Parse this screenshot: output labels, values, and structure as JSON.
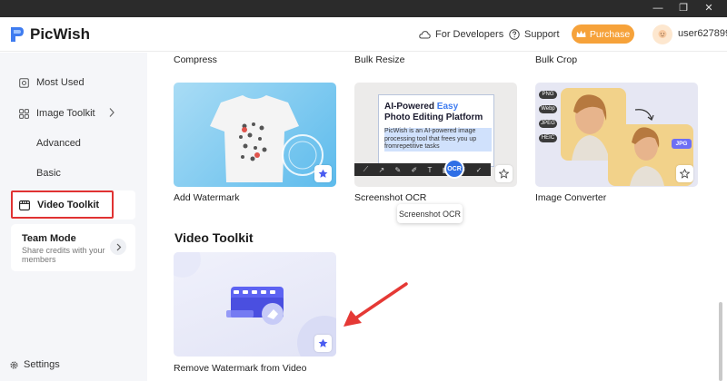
{
  "window": {
    "controls": [
      "minimize-icon",
      "restore-icon",
      "close-icon"
    ],
    "minimize_glyph": "—",
    "restore_glyph": "❐",
    "close_glyph": "✕"
  },
  "header": {
    "app_name": "PicWish",
    "links": [
      {
        "label": "For Developers",
        "icon": "cloud-icon"
      },
      {
        "label": "Support",
        "icon": "help-circle-icon"
      }
    ],
    "purchase_label": "Purchase",
    "username": "user627899"
  },
  "sidebar": {
    "items": [
      {
        "label": "Most Used",
        "icon": "most-used-icon"
      },
      {
        "label": "Image Toolkit",
        "icon": "grid-icon"
      },
      {
        "label": "Advanced"
      },
      {
        "label": "Basic"
      },
      {
        "label": "Video Toolkit",
        "icon": "video-icon",
        "active": true
      }
    ],
    "team": {
      "title": "Team Mode",
      "description": "Share credits with your members"
    },
    "settings_label": "Settings"
  },
  "main": {
    "top_labels": [
      "Compress",
      "Bulk Resize",
      "Bulk Crop"
    ],
    "image_tools": [
      {
        "label": "Add Watermark"
      },
      {
        "label": "Screenshot OCR"
      },
      {
        "label": "Image Converter"
      }
    ],
    "ocr_card": {
      "heading_line1_a": "AI-Powered ",
      "heading_line1_b": "Easy",
      "heading_line2": "Photo Editing Platform",
      "body": "PicWish is an AI-powered image processing tool that frees you up fromrepetitive tasks",
      "badge": "OCR"
    },
    "converter_card": {
      "formats": [
        "PNG",
        "Webp",
        "JPEG",
        "HEIC"
      ],
      "output_format": "JPG"
    },
    "tooltip": "Screenshot OCR",
    "section_title": "Video Toolkit",
    "video_tools": [
      {
        "label": "Remove Watermark from Video"
      }
    ]
  },
  "colors": {
    "accent_purchase": "#f6a23a",
    "active_outline": "#e03232",
    "annotation_arrow": "#e53935",
    "brand_blue": "#2f6fe6",
    "star_fill": "#4a5cf0"
  }
}
